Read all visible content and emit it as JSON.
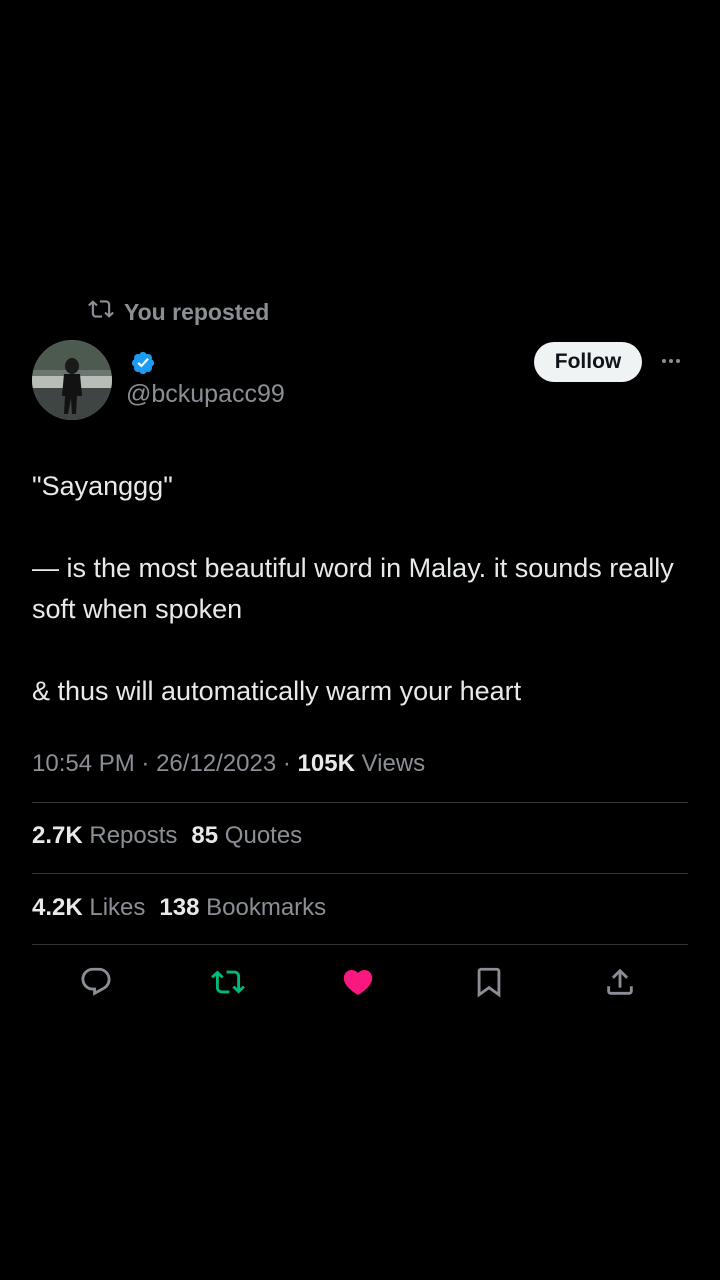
{
  "repost_banner": {
    "text": "You reposted",
    "icon": "repost-icon"
  },
  "author": {
    "handle": "@bckupacc99",
    "verified": true,
    "verified_color": "#1d9bf0"
  },
  "follow_button": {
    "label": "Follow"
  },
  "tweet": {
    "lines": [
      "\"Sayanggg\"",
      "— is the most beautiful word in Malay. it sounds really soft when spoken",
      "& thus will automatically warm your heart"
    ]
  },
  "meta": {
    "time": "10:54 PM",
    "separator": "·",
    "date": "26/12/2023",
    "views_count": "105K",
    "views_label": "Views"
  },
  "stats": {
    "reposts_count": "2.7K",
    "reposts_label": "Reposts",
    "quotes_count": "85",
    "quotes_label": "Quotes",
    "likes_count": "4.2K",
    "likes_label": "Likes",
    "bookmarks_count": "138",
    "bookmarks_label": "Bookmarks"
  },
  "actions": [
    {
      "icon": "reply-icon"
    },
    {
      "icon": "repost-icon",
      "active": true,
      "color": "#00ba7c"
    },
    {
      "icon": "heart-icon",
      "active": true,
      "color": "#f91880"
    },
    {
      "icon": "bookmark-icon"
    },
    {
      "icon": "share-icon"
    }
  ],
  "colors": {
    "background": "#000000",
    "text_primary": "#e7e9ea",
    "text_secondary": "#8b8f95",
    "divider": "#2f3336",
    "repost_active": "#00ba7c",
    "like_active": "#f91880",
    "verified": "#1d9bf0"
  }
}
